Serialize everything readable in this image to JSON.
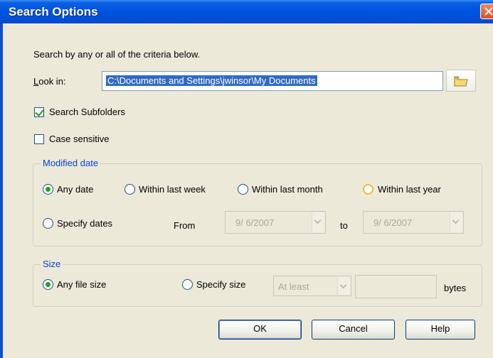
{
  "window": {
    "title": "Search Options"
  },
  "intro": "Search by any or all of the criteria below.",
  "look_in": {
    "label": "Look in:",
    "value": "C:\\Documents and Settings\\jwinsor\\My Documents"
  },
  "search_subfolders": {
    "label": "Search Subfolders",
    "checked": true
  },
  "case_sensitive": {
    "label": "Case sensitive",
    "checked": false
  },
  "modified_date": {
    "legend": "Modified date",
    "any_date": "Any date",
    "within_last_week": "Within last week",
    "within_last_month": "Within last month",
    "within_last_year": "Within last year",
    "specify_dates": "Specify dates",
    "from_label": "From",
    "from_value": "9/ 6/2007",
    "to_label": "to",
    "to_value": "9/ 6/2007"
  },
  "size": {
    "legend": "Size",
    "any_file_size": "Any file size",
    "specify_size": "Specify size",
    "comparison": "At least",
    "bytes_value": "",
    "bytes_label": "bytes"
  },
  "buttons": {
    "ok": "OK",
    "cancel": "Cancel",
    "help": "Help"
  },
  "colors": {
    "title_bar": "#0054e3",
    "dialog_bg": "#ece9d8",
    "group_label": "#0046d5",
    "check_accent": "#21a121"
  }
}
